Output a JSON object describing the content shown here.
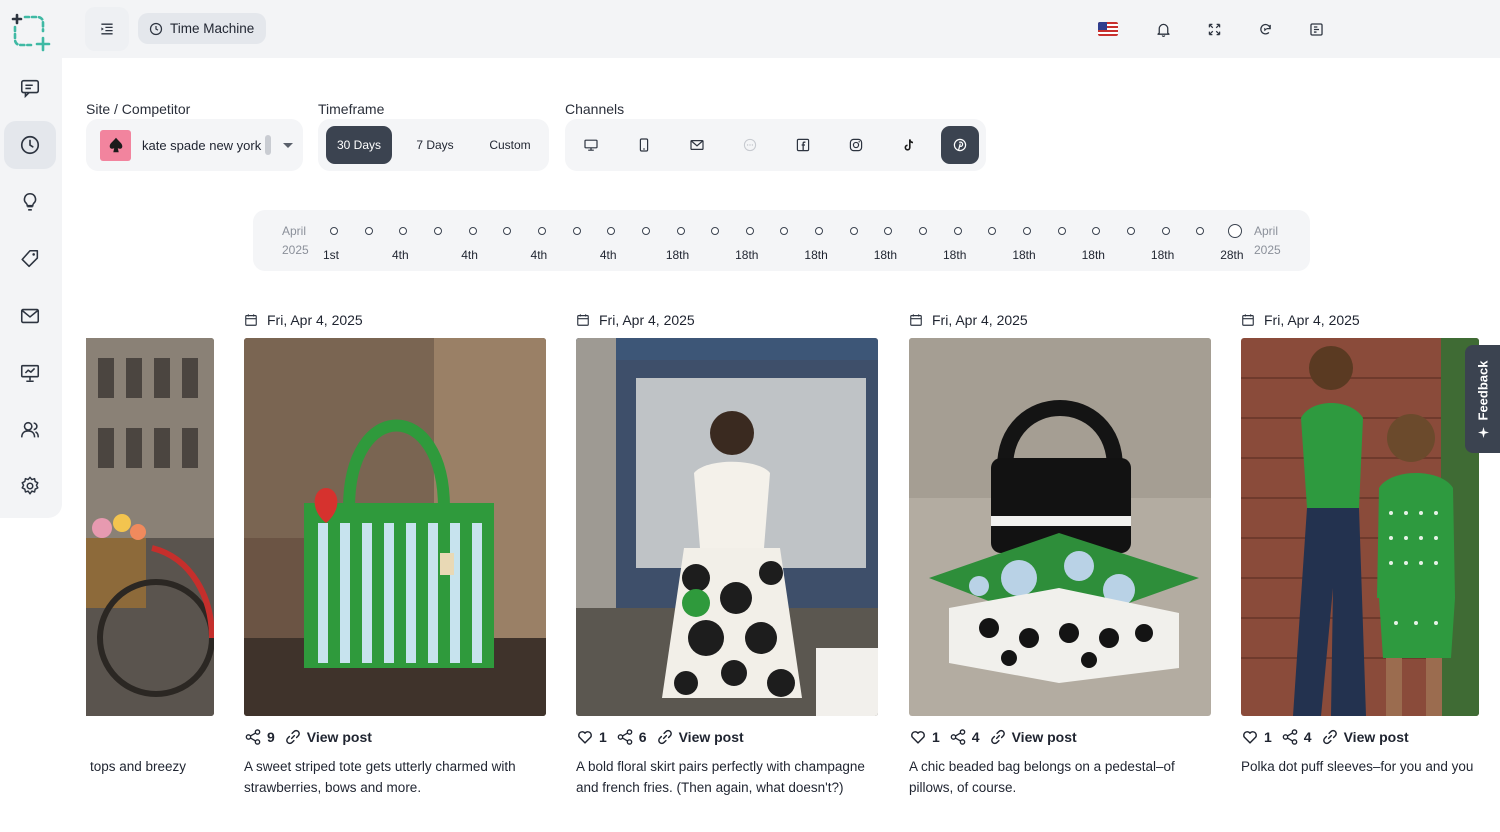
{
  "app": {
    "logo_icon": "crop-plus-logo-icon",
    "accent_color": "#3fb9a4",
    "dark_color": "#3b4350"
  },
  "header": {
    "time_machine_label": "Time Machine",
    "icons": [
      "menu-collapse-icon",
      "us-flag-icon",
      "bell-icon",
      "fullscreen-icon",
      "refresh-icon",
      "export-icon"
    ]
  },
  "sidebar": {
    "items": [
      {
        "name": "chat-icon",
        "active": false
      },
      {
        "name": "clock-icon",
        "active": true
      },
      {
        "name": "lightbulb-icon",
        "active": false
      },
      {
        "name": "tag-icon",
        "active": false
      },
      {
        "name": "mail-icon",
        "active": false
      },
      {
        "name": "presentation-icon",
        "active": false
      },
      {
        "name": "users-icon",
        "active": false
      },
      {
        "name": "gear-icon",
        "active": false
      }
    ]
  },
  "filters": {
    "site_label": "Site / Competitor",
    "site_value": "kate spade new york",
    "site_logo_icon": "spade-icon",
    "site_logo_color": "#f2849e",
    "timeframe_label": "Timeframe",
    "timeframe_options": [
      "30 Days",
      "7 Days",
      "Custom"
    ],
    "timeframe_selected": "30 Days",
    "channels_label": "Channels",
    "channels": [
      {
        "name": "desktop-icon",
        "active": false
      },
      {
        "name": "mobile-icon",
        "active": false
      },
      {
        "name": "email-icon",
        "active": false
      },
      {
        "name": "sms-icon",
        "active": false,
        "disabled": true
      },
      {
        "name": "facebook-icon",
        "active": false
      },
      {
        "name": "instagram-icon",
        "active": false
      },
      {
        "name": "tiktok-icon",
        "active": false
      },
      {
        "name": "pinterest-icon",
        "active": true
      }
    ]
  },
  "timeline": {
    "start_month": "April",
    "start_year": "2025",
    "end_month": "April",
    "end_year": "2025",
    "labels": [
      "1st",
      "4th",
      "4th",
      "4th",
      "4th",
      "18th",
      "18th",
      "18th",
      "18th",
      "18th",
      "18th",
      "18th",
      "18th",
      "28th"
    ],
    "dot_count": 27,
    "selected_index": 26
  },
  "posts": [
    {
      "date": "",
      "stats": [],
      "view_label": "",
      "description": "tops and breezy",
      "image": "bicycle-flower-basket-street-photo"
    },
    {
      "date": "Fri, Apr 4, 2025",
      "likes": null,
      "shares": "9",
      "view_label": "View post",
      "description": "A sweet striped tote gets utterly charmed with strawberries, bows and more.",
      "image": "green-striped-tote-photo"
    },
    {
      "date": "Fri, Apr 4, 2025",
      "likes": "1",
      "shares": "6",
      "view_label": "View post",
      "description": "A bold floral skirt pairs perfectly with champagne and french fries. (Then again, what doesn't?)",
      "image": "woman-floral-skirt-storefront-photo"
    },
    {
      "date": "Fri, Apr 4, 2025",
      "likes": "1",
      "shares": "4",
      "view_label": "View post",
      "description": "A chic beaded bag belongs on a pedestal–of pillows, of course.",
      "image": "beaded-bag-on-pillows-photo"
    },
    {
      "date": "Fri, Apr 4, 2025",
      "likes": "1",
      "shares": "4",
      "view_label": "View post",
      "description": "Polka dot puff sleeves–for you and you",
      "image": "mother-daughter-green-outfits-photo"
    }
  ],
  "feedback": {
    "label": "Feedback"
  }
}
